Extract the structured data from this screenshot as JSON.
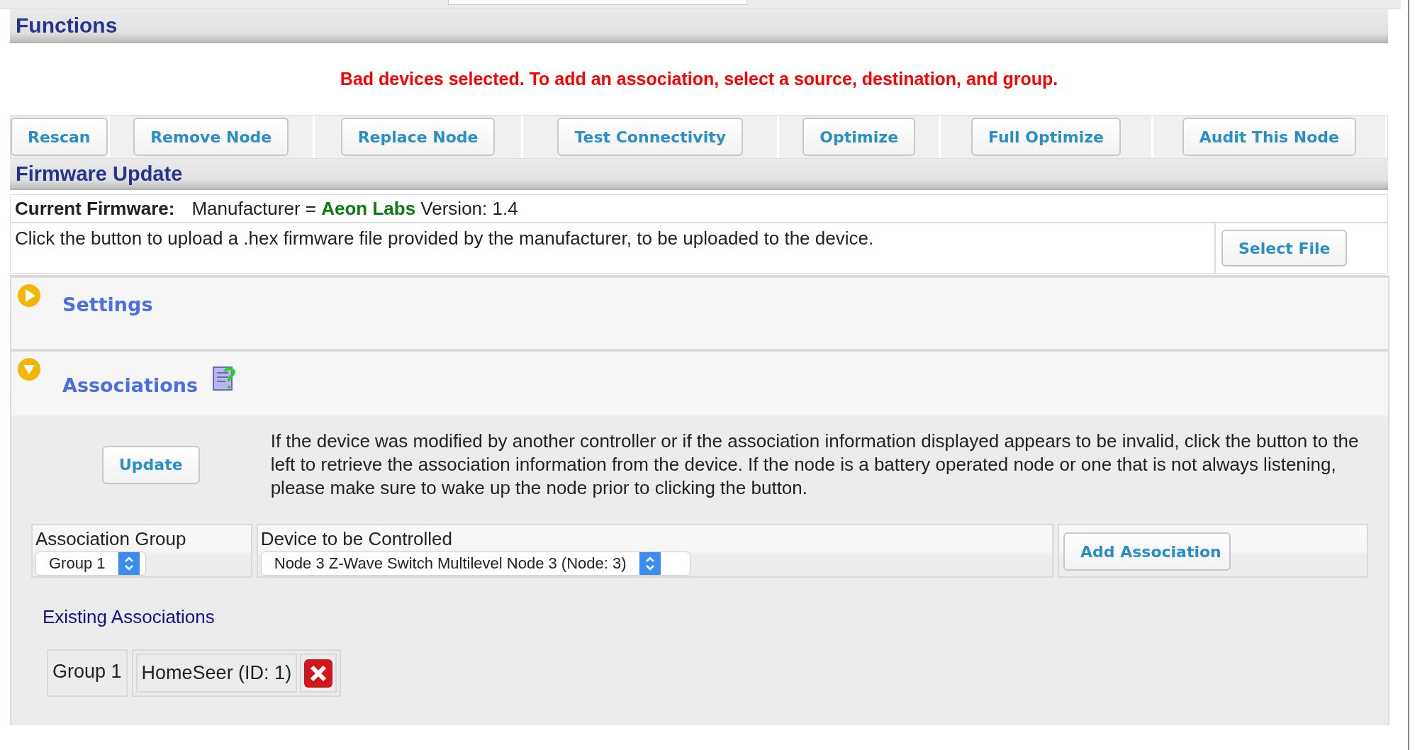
{
  "functions": {
    "title": "Functions",
    "message": "Bad devices selected. To add an association, select a source, destination, and group.",
    "buttons": [
      "Rescan",
      "Remove Node",
      "Replace Node",
      "Test Connectivity",
      "Optimize",
      "Full Optimize",
      "Audit This Node"
    ]
  },
  "firmware": {
    "title": "Firmware Update",
    "current_label": "Current Firmware:",
    "current_value": "Manufacturer = **Aeon Labs** Version: 1.4",
    "instructions": "Click the button to upload a .hex firmware file provided by the manufacturer, to be uploaded to the device.",
    "button": "Select File"
  },
  "sections": [
    {
      "title": "Settings",
      "expanded": false
    },
    {
      "title": "Associations",
      "expanded": true
    }
  ],
  "associations": {
    "update_button": "Update",
    "update_text": "If the device was modified by another controller or if the association information displayed appears to be invalid, click the button to the left to retrieve the association information from the device. If the node is a battery operated node or one that is not always listening, please make sure to wake up the node prior to clicking the button.",
    "group_label": "Association Group",
    "group_value": "Group 1",
    "device_label": "Device to be Controlled",
    "device_value": "Node 3 Z-Wave Switch Multilevel Node 3 (Node: 3)",
    "add_button": "Add Association",
    "existing_title": "Existing Associations",
    "existing": [
      {
        "group": "Group 1",
        "device": "HomeSeer (ID: 1)"
      }
    ]
  }
}
